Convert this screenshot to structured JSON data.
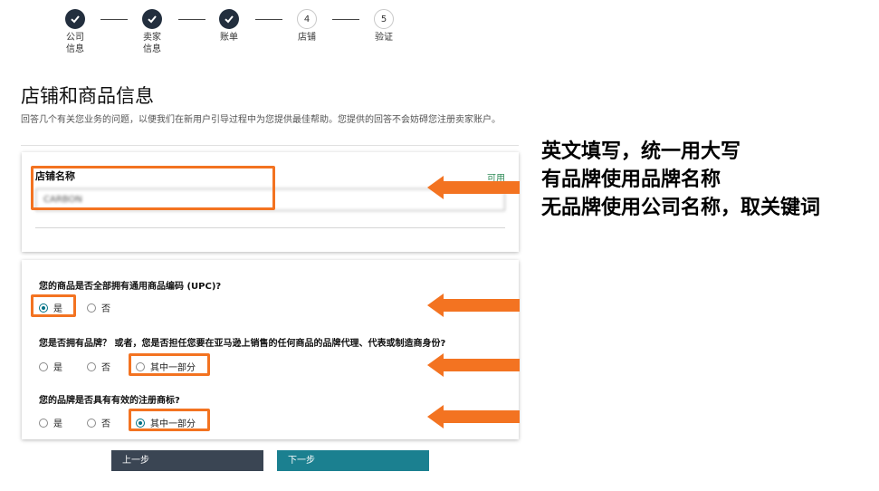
{
  "stepper": {
    "steps": [
      {
        "label": "公司\n信息",
        "number": "1",
        "status": "done"
      },
      {
        "label": "卖家\n信息",
        "number": "2",
        "status": "done"
      },
      {
        "label": "账单",
        "number": "3",
        "status": "done"
      },
      {
        "label": "店铺",
        "number": "4",
        "status": "todo"
      },
      {
        "label": "验证",
        "number": "5",
        "status": "todo"
      }
    ]
  },
  "page": {
    "title": "店铺和商品信息",
    "subtitle": "回答几个有关您业务的问题，以便我们在新用户引导过程中为您提供最佳帮助。您提供的回答不会妨碍您注册卖家账户。"
  },
  "store": {
    "label": "店铺名称",
    "availability": "可用",
    "value": "CARBON"
  },
  "questions": [
    {
      "text": "您的商品是否全部拥有通用商品编码 (UPC)?",
      "options": [
        "是",
        "否"
      ],
      "selected": 0
    },
    {
      "text": "您是否拥有品牌？ 或者，您是否担任您要在亚马逊上销售的任何商品的品牌代理、代表或制造商身份?",
      "options": [
        "是",
        "否",
        "其中一部分"
      ],
      "selected": -1
    },
    {
      "text": "您的品牌是否具有有效的注册商标?",
      "options": [
        "是",
        "否",
        "其中一部分"
      ],
      "selected": 2
    }
  ],
  "buttons": {
    "prev": "上一步",
    "next": "下一步"
  },
  "annotation": {
    "lines": [
      "英文填写，统一用大写",
      "有品牌使用品牌名称",
      "无品牌使用公司名称，取关键词"
    ]
  },
  "colors": {
    "highlight": "#f37321",
    "accent": "#007185",
    "next_button": "#1b8090",
    "prev_button": "#3a4553"
  }
}
